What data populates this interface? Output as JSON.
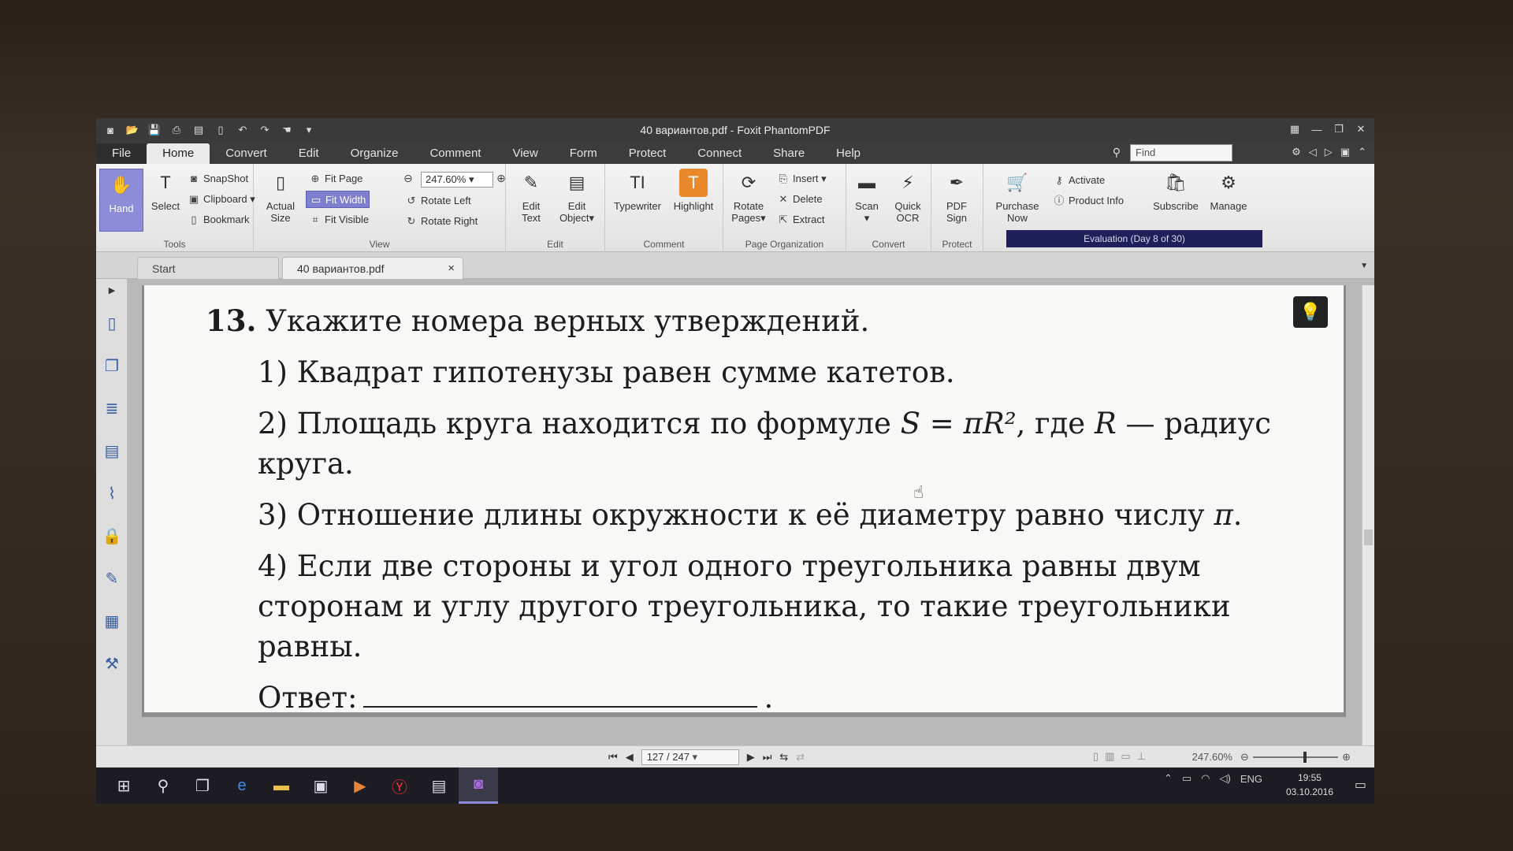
{
  "window": {
    "title": "40 вариантов.pdf - Foxit PhantomPDF"
  },
  "menu": {
    "tabs": [
      "File",
      "Home",
      "Convert",
      "Edit",
      "Organize",
      "Comment",
      "View",
      "Form",
      "Protect",
      "Connect",
      "Share",
      "Help"
    ],
    "active": "Home",
    "find_placeholder": "Find"
  },
  "ribbon": {
    "tools": {
      "label": "Tools",
      "hand": "Hand",
      "select": "Select",
      "snapshot": "SnapShot",
      "clipboard": "Clipboard",
      "bookmark": "Bookmark"
    },
    "view": {
      "label": "View",
      "actual_size_1": "Actual",
      "actual_size_2": "Size",
      "fit_page": "Fit Page",
      "fit_width": "Fit Width",
      "fit_visible": "Fit Visible",
      "zoom_value": "247.60%",
      "rotate_left": "Rotate Left",
      "rotate_right": "Rotate Right"
    },
    "edit": {
      "label": "Edit",
      "edit_text_1": "Edit",
      "edit_text_2": "Text",
      "edit_object_1": "Edit",
      "edit_object_2": "Object"
    },
    "comment": {
      "label": "Comment",
      "typewriter": "Typewriter",
      "highlight": "Highlight"
    },
    "page_org": {
      "label": "Page Organization",
      "rotate_pages_1": "Rotate",
      "rotate_pages_2": "Pages",
      "insert": "Insert",
      "delete": "Delete",
      "extract": "Extract"
    },
    "convert": {
      "label": "Convert",
      "scan": "Scan",
      "quick_ocr_1": "Quick",
      "quick_ocr_2": "OCR"
    },
    "protect": {
      "label": "Protect",
      "pdf_sign_1": "PDF",
      "pdf_sign_2": "Sign"
    },
    "purchase": {
      "purchase_1": "Purchase",
      "purchase_2": "Now",
      "activate": "Activate",
      "product_info": "Product Info",
      "subscribe": "Subscribe",
      "manage": "Manage",
      "evaluation": "Evaluation (Day 8 of 30)"
    }
  },
  "doc_tabs": {
    "start": "Start",
    "file": "40 вариантов.pdf"
  },
  "document": {
    "q_num": "13.",
    "q_text": "Укажите номера верных утверждений.",
    "s1": "1)  Квадрат гипотенузы равен сумме катетов.",
    "s2_a": "2)  Площадь круга находится по формуле ",
    "s2_math": "S = πR²",
    "s2_b": ", где ",
    "s2_r": "R",
    "s2_c": " — радиус круга.",
    "s3_a": "3)  Отношение длины окружности к её диаметру равно числу ",
    "s3_pi": "π",
    "s3_b": ".",
    "s4": "4)  Если две стороны и угол одного треугольника равны двум сторонам и углу другого треугольника, то такие треугольники равны.",
    "answer_label": "Ответ:",
    "answer_end": "."
  },
  "status": {
    "page": "127 / 247",
    "zoom": "247.60%"
  },
  "taskbar": {
    "lang": "ENG",
    "time": "19:55",
    "date": "03.10.2016"
  }
}
